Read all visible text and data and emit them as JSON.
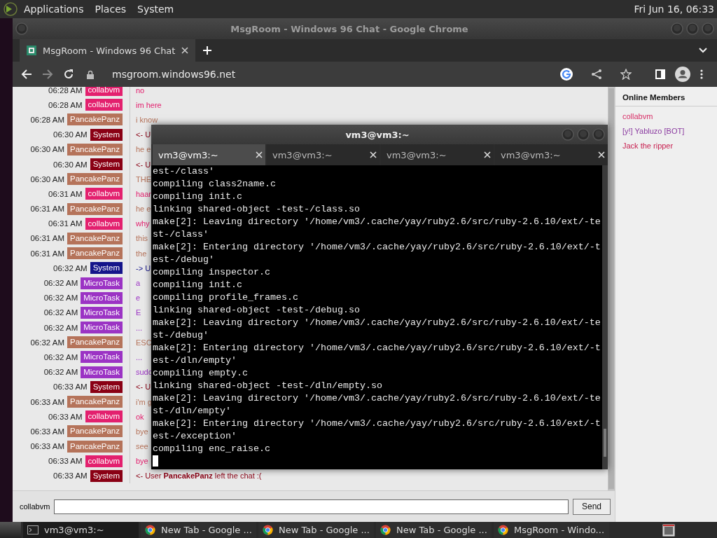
{
  "top_panel": {
    "menus": [
      "Applications",
      "Places",
      "System"
    ],
    "clock": "Fri Jun 16, 06:33"
  },
  "browser": {
    "window_title": "MsgRoom - Windows 96 Chat - Google Chrome",
    "tabs": [
      {
        "title": "MsgRoom - Windows 96 Chat",
        "selected": true
      }
    ],
    "url": "msgroom.windows96.net"
  },
  "chat": {
    "messages": [
      {
        "time": "06:28 AM",
        "user": "collabvm",
        "color": "#e3206e",
        "text": "no"
      },
      {
        "time": "06:28 AM",
        "user": "collabvm",
        "color": "#e3206e",
        "text": "im here"
      },
      {
        "time": "06:28 AM",
        "user": "PancakePanz",
        "color": "#b5735a",
        "text": "i know"
      },
      {
        "time": "06:30 AM",
        "user": "System",
        "color": "#8a0014",
        "text": "<- U"
      },
      {
        "time": "06:30 AM",
        "user": "PancakePanz",
        "color": "#b5735a",
        "text": "he e"
      },
      {
        "time": "06:30 AM",
        "user": "System",
        "color": "#8a0014",
        "text": "<- U"
      },
      {
        "time": "06:30 AM",
        "user": "PancakePanz",
        "color": "#b5735a",
        "text": "THE"
      },
      {
        "time": "06:31 AM",
        "user": "collabvm",
        "color": "#e3206e",
        "text": "haar"
      },
      {
        "time": "06:31 AM",
        "user": "PancakePanz",
        "color": "#b5735a",
        "text": "he e"
      },
      {
        "time": "06:31 AM",
        "user": "collabvm",
        "color": "#e3206e",
        "text": "why"
      },
      {
        "time": "06:31 AM",
        "user": "PancakePanz",
        "color": "#b5735a",
        "text": "this"
      },
      {
        "time": "06:31 AM",
        "user": "PancakePanz",
        "color": "#b5735a",
        "text": "the"
      },
      {
        "time": "06:32 AM",
        "user": "System",
        "color": "#14148a",
        "text": "-> U"
      },
      {
        "time": "06:32 AM",
        "user": "MicroTask",
        "color": "#9b33c4",
        "text": "a"
      },
      {
        "time": "06:32 AM",
        "user": "MicroTask",
        "color": "#9b33c4",
        "text": "e"
      },
      {
        "time": "06:32 AM",
        "user": "MicroTask",
        "color": "#9b33c4",
        "text": "E"
      },
      {
        "time": "06:32 AM",
        "user": "MicroTask",
        "color": "#9b33c4",
        "text": "..."
      },
      {
        "time": "06:32 AM",
        "user": "PancakePanz",
        "color": "#b5735a",
        "text": "ESC"
      },
      {
        "time": "06:32 AM",
        "user": "MicroTask",
        "color": "#9b33c4",
        "text": "..."
      },
      {
        "time": "06:32 AM",
        "user": "MicroTask",
        "color": "#9b33c4",
        "text": "sudo"
      },
      {
        "time": "06:33 AM",
        "user": "System",
        "color": "#8a0014",
        "text": "<- U"
      },
      {
        "time": "06:33 AM",
        "user": "PancakePanz",
        "color": "#b5735a",
        "text": "i'm g"
      },
      {
        "time": "06:33 AM",
        "user": "collabvm",
        "color": "#e3206e",
        "text": "ok"
      },
      {
        "time": "06:33 AM",
        "user": "PancakePanz",
        "color": "#b5735a",
        "text": "bye"
      },
      {
        "time": "06:33 AM",
        "user": "PancakePanz",
        "color": "#b5735a",
        "text": "see"
      },
      {
        "time": "06:33 AM",
        "user": "collabvm",
        "color": "#e3206e",
        "text": "bye"
      },
      {
        "time": "06:33 AM",
        "user": "System",
        "color": "#8a0014",
        "text": "<- User **PancakePanz** left the chat :("
      }
    ],
    "online_members": {
      "title": "Online Members",
      "members": [
        {
          "name": "collabvm",
          "color": "#d83068"
        },
        {
          "name": "[y!] Yabluzo [BOT]",
          "color": "#8a3aa0"
        },
        {
          "name": "Jack the ripper",
          "color": "#c82050"
        }
      ]
    },
    "composer": {
      "nickname": "collabvm",
      "send": "Send"
    }
  },
  "terminal": {
    "title": "vm3@vm3:~",
    "tabs": [
      {
        "title": "vm3@vm3:~",
        "selected": true
      },
      {
        "title": "vm3@vm3:~",
        "selected": false
      },
      {
        "title": "vm3@vm3:~",
        "selected": false
      },
      {
        "title": "vm3@vm3:~",
        "selected": false
      }
    ],
    "lines": [
      "est-/class'",
      "compiling class2name.c",
      "compiling init.c",
      "linking shared-object -test-/class.so",
      "make[2]: Leaving directory '/home/vm3/.cache/yay/ruby2.6/src/ruby-2.6.10/ext/-te",
      "st-/class'",
      "make[2]: Entering directory '/home/vm3/.cache/yay/ruby2.6/src/ruby-2.6.10/ext/-t",
      "est-/debug'",
      "compiling inspector.c",
      "compiling init.c",
      "compiling profile_frames.c",
      "linking shared-object -test-/debug.so",
      "make[2]: Leaving directory '/home/vm3/.cache/yay/ruby2.6/src/ruby-2.6.10/ext/-te",
      "st-/debug'",
      "make[2]: Entering directory '/home/vm3/.cache/yay/ruby2.6/src/ruby-2.6.10/ext/-t",
      "est-/dln/empty'",
      "compiling empty.c",
      "linking shared-object -test-/dln/empty.so",
      "make[2]: Leaving directory '/home/vm3/.cache/yay/ruby2.6/src/ruby-2.6.10/ext/-te",
      "st-/dln/empty'",
      "make[2]: Entering directory '/home/vm3/.cache/yay/ruby2.6/src/ruby-2.6.10/ext/-t",
      "est-/exception'",
      "compiling enc_raise.c"
    ]
  },
  "taskbar": {
    "tasks": [
      {
        "kind": "terminal",
        "title": "vm3@vm3:~",
        "selected": true
      },
      {
        "kind": "browser",
        "title": "New Tab - Google ...",
        "selected": false
      },
      {
        "kind": "browser",
        "title": "New Tab - Google ...",
        "selected": false
      },
      {
        "kind": "browser",
        "title": "New Tab - Google ...",
        "selected": false
      },
      {
        "kind": "browser",
        "title": "MsgRoom - Windo...",
        "selected": false
      }
    ]
  }
}
